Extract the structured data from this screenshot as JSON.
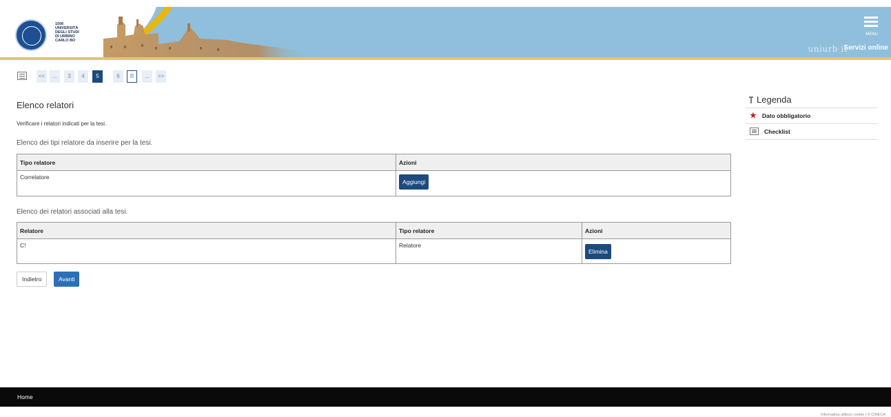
{
  "header": {
    "university_lines": [
      "1506",
      "UNIVERSITÀ",
      "DEGLI STUDI",
      "DI URBINO",
      "CARLO BO"
    ],
    "menu_label": "MENU",
    "brand_prefix": "uniurb",
    "brand_dot": "·",
    "brand_suffix": "it",
    "services_label": "Servizi online"
  },
  "pagination": {
    "pages": [
      "<<",
      "...",
      "3",
      "4",
      "5",
      "6",
      "B",
      "...",
      ">>"
    ],
    "active": "5",
    "outlined": "B"
  },
  "main": {
    "title": "Elenco relatori",
    "instruction": "Verificare i relatori indicati per la tesi.",
    "types_section": {
      "heading": "Elenco dei tipi relatore da inserire per la tesi.",
      "columns": [
        "Tipo relatore",
        "Azioni"
      ],
      "rows": [
        {
          "tipo": "Correlatore",
          "action": "Aggiungi"
        }
      ]
    },
    "assoc_section": {
      "heading": "Elenco dei relatori associati alla tesi.",
      "columns": [
        "Relatore",
        "Tipo relatore",
        "Azioni"
      ],
      "rows": [
        {
          "relatore": "C!",
          "tipo": "Relatore",
          "action": "Elimina"
        }
      ]
    },
    "back_label": "Indietro",
    "next_label": "Avanti"
  },
  "legend": {
    "title": "Legenda",
    "items": [
      {
        "icon": "required-star-icon",
        "label": "Dato obbligatorio"
      },
      {
        "icon": "checklist-icon",
        "label": "Checklist"
      }
    ]
  },
  "footer": {
    "home_label": "Home",
    "copyright": "Informativa utilizzo cookie | © CINECA"
  },
  "colors": {
    "header_bg": "#8fbfdc",
    "accent_gold": "#e8b70a",
    "primary_dark": "#1c4a7e",
    "primary_button": "#2d6fb6",
    "required_red": "#cc1f1f"
  }
}
